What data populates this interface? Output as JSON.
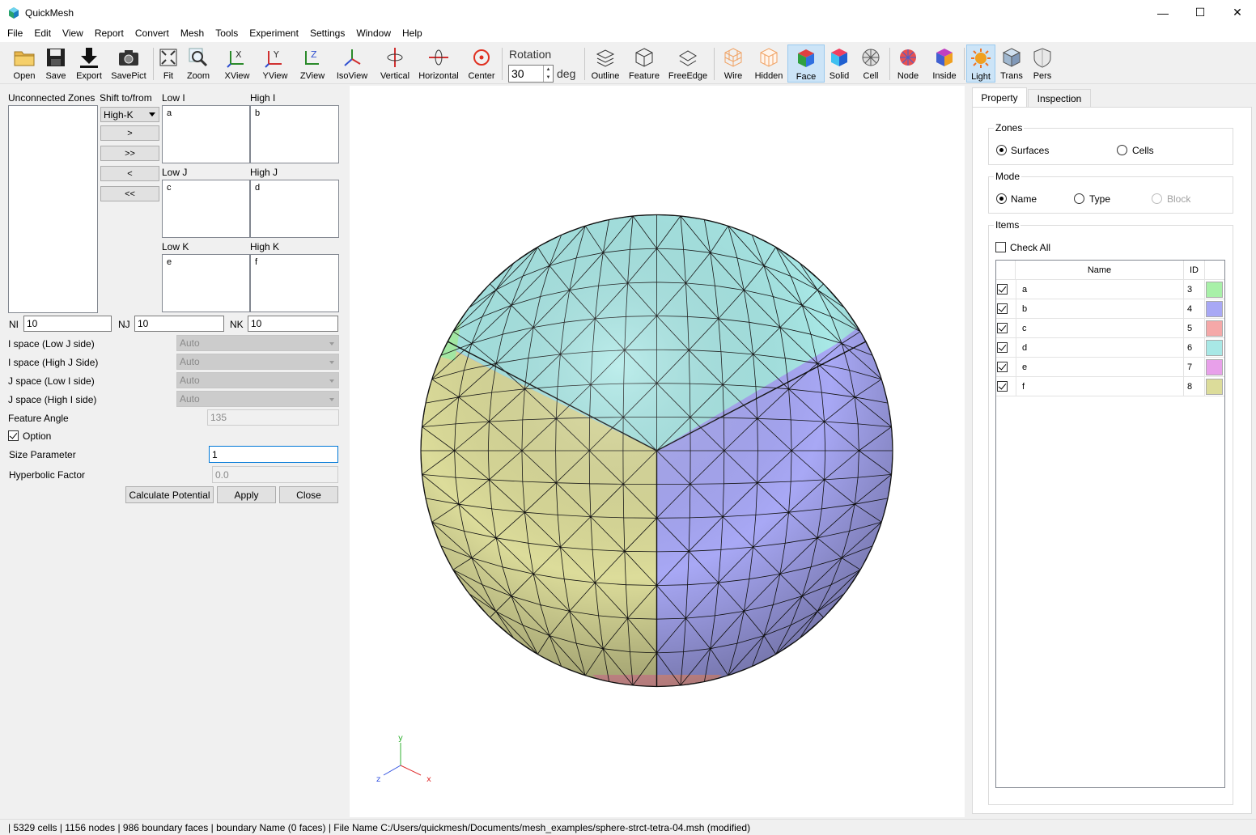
{
  "window": {
    "title": "QuickMesh",
    "minimize": "—",
    "maximize": "☐",
    "close": "✕"
  },
  "menu": [
    "File",
    "Edit",
    "View",
    "Report",
    "Convert",
    "Mesh",
    "Tools",
    "Experiment",
    "Settings",
    "Window",
    "Help"
  ],
  "toolbar": {
    "open": "Open",
    "save": "Save",
    "export": "Export",
    "savepict": "SavePict",
    "fit": "Fit",
    "zoom": "Zoom",
    "xview": "XView",
    "yview": "YView",
    "zview": "ZView",
    "isoview": "IsoView",
    "vertical": "Vertical",
    "horizontal": "Horizontal",
    "center": "Center",
    "rotation_label": "Rotation",
    "rotation_value": "30",
    "rotation_unit": "deg",
    "outline": "Outline",
    "feature": "Feature",
    "freeedge": "FreeEdge",
    "wire": "Wire",
    "hidden": "Hidden",
    "face": "Face",
    "solid": "Solid",
    "cell": "Cell",
    "node": "Node",
    "inside": "Inside",
    "light": "Light",
    "trans": "Trans",
    "pers": "Pers"
  },
  "left": {
    "unconnected_label": "Unconnected Zones",
    "shift_label": "Shift to/from",
    "shift_target": "High-K",
    "btn_add": ">",
    "btn_add_all": ">>",
    "btn_remove": "<",
    "btn_remove_all": "<<",
    "low_i": "Low I",
    "high_i": "High I",
    "low_j": "Low J",
    "high_j": "High J",
    "low_k": "Low K",
    "high_k": "High K",
    "low_i_items": [
      "a"
    ],
    "high_i_items": [
      "b"
    ],
    "low_j_items": [
      "c"
    ],
    "high_j_items": [
      "d"
    ],
    "low_k_items": [
      "e"
    ],
    "high_k_items": [
      "f"
    ],
    "ni_label": "NI",
    "ni_value": "10",
    "nj_label": "NJ",
    "nj_value": "10",
    "nk_label": "NK",
    "nk_value": "10",
    "ispace_low_j_label": "I space (Low J side)",
    "ispace_low_j": "Auto",
    "ispace_high_j_label": "I space (High J Side)",
    "ispace_high_j": "Auto",
    "jspace_low_i_label": "J space (Low I side)",
    "jspace_low_i": "Auto",
    "jspace_high_i_label": "J space (High I side)",
    "jspace_high_i": "Auto",
    "feature_angle_label": "Feature Angle",
    "feature_angle": "135",
    "option_label": "Option",
    "size_param_label": "Size Parameter",
    "size_param": "1",
    "hyperbolic_label": "Hyperbolic Factor",
    "hyperbolic": "0.0",
    "calc_btn": "Calculate Potential",
    "apply_btn": "Apply",
    "close_btn": "Close"
  },
  "axes": {
    "x": "x",
    "y": "y",
    "z": "z"
  },
  "right": {
    "tab_property": "Property",
    "tab_inspection": "Inspection",
    "zones_label": "Zones",
    "surfaces": "Surfaces",
    "cells": "Cells",
    "mode_label": "Mode",
    "mode_name": "Name",
    "mode_type": "Type",
    "mode_block": "Block",
    "items_label": "Items",
    "check_all": "Check All",
    "col_name": "Name",
    "col_id": "ID",
    "rows": [
      {
        "name": "a",
        "id": "3",
        "color": "#a8f0a8"
      },
      {
        "name": "b",
        "id": "4",
        "color": "#a8a8f5"
      },
      {
        "name": "c",
        "id": "5",
        "color": "#f5a8a8"
      },
      {
        "name": "d",
        "id": "6",
        "color": "#a8e8e6"
      },
      {
        "name": "e",
        "id": "7",
        "color": "#e8a0ea"
      },
      {
        "name": "f",
        "id": "8",
        "color": "#dcdc9a"
      }
    ]
  },
  "status": "| 5329 cells | 1156 nodes | 986 boundary faces |  boundary Name  (0 faces) | File Name C:/Users/quickmesh/Documents/mesh_examples/sphere-strct-tetra-04.msh (modified)"
}
